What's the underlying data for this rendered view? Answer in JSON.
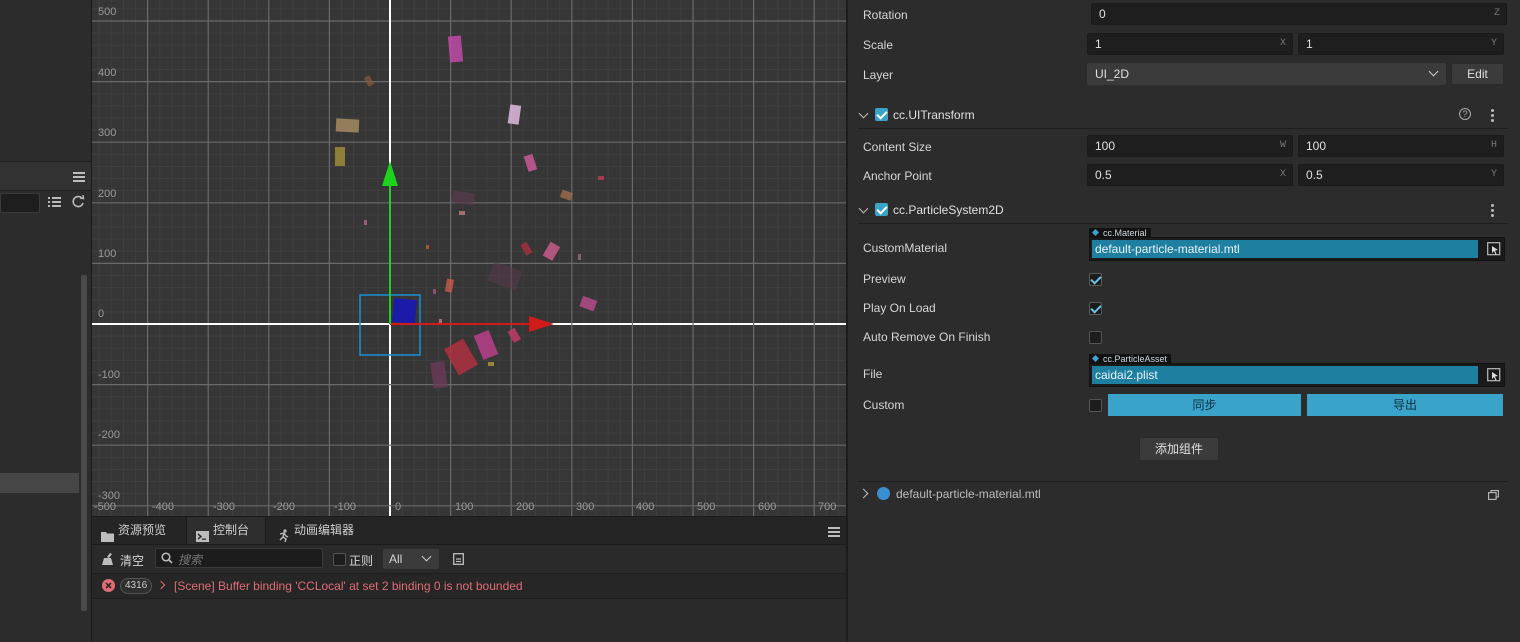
{
  "scene": {
    "y_axis_labels": [
      "500",
      "400",
      "300",
      "200",
      "100",
      "0",
      "-100",
      "-200",
      "-300"
    ],
    "x_axis_labels": [
      "-500",
      "-400",
      "-300",
      "-200",
      "-100",
      "0",
      "100",
      "200",
      "300",
      "400",
      "500",
      "600",
      "700"
    ]
  },
  "console": {
    "tabs": [
      {
        "label": "资源预览",
        "icon": "folder-icon"
      },
      {
        "label": "控制台",
        "icon": "terminal-icon"
      },
      {
        "label": "动画编辑器",
        "icon": "running-figure-icon"
      }
    ],
    "clear_label": "清空",
    "search_placeholder": "搜索",
    "regex_label": "正则",
    "filter_value": "All",
    "log": {
      "count": "4316",
      "message": "[Scene] Buffer binding 'CCLocal' at set 2 binding 0 is not bounded"
    }
  },
  "inspector": {
    "rotation": {
      "label": "Rotation",
      "value": "0",
      "suffix": "Z"
    },
    "scale": {
      "label": "Scale",
      "x": "1",
      "x_suffix": "X",
      "y": "1",
      "y_suffix": "Y"
    },
    "layer": {
      "label": "Layer",
      "value": "UI_2D",
      "edit_label": "Edit"
    },
    "ui_transform": {
      "title": "cc.UITransform",
      "content_size": {
        "label": "Content Size",
        "w": "100",
        "w_suffix": "W",
        "h": "100",
        "h_suffix": "H"
      },
      "anchor_point": {
        "label": "Anchor Point",
        "x": "0.5",
        "x_suffix": "X",
        "y": "0.5",
        "y_suffix": "Y"
      }
    },
    "particle_system": {
      "title": "cc.ParticleSystem2D",
      "custom_material": {
        "label": "CustomMaterial",
        "type": "cc.Material",
        "value": "default-particle-material.mtl"
      },
      "preview": {
        "label": "Preview",
        "checked": true
      },
      "play_on_load": {
        "label": "Play On Load",
        "checked": true
      },
      "auto_remove": {
        "label": "Auto Remove On Finish",
        "checked": false
      },
      "file": {
        "label": "File",
        "type": "cc.ParticleAsset",
        "value": "caidai2.plist"
      },
      "custom": {
        "label": "Custom",
        "checked": false,
        "sync_label": "同步",
        "export_label": "导出"
      }
    },
    "add_component_label": "添加组件",
    "material_asset": {
      "label": "default-particle-material.mtl"
    }
  },
  "colors": {
    "accent": "#3aa3c9",
    "asset_field": "#1f7fa0",
    "error": "#e06c75",
    "x_axis": "#d11b1b",
    "y_axis": "#1fd11f"
  }
}
